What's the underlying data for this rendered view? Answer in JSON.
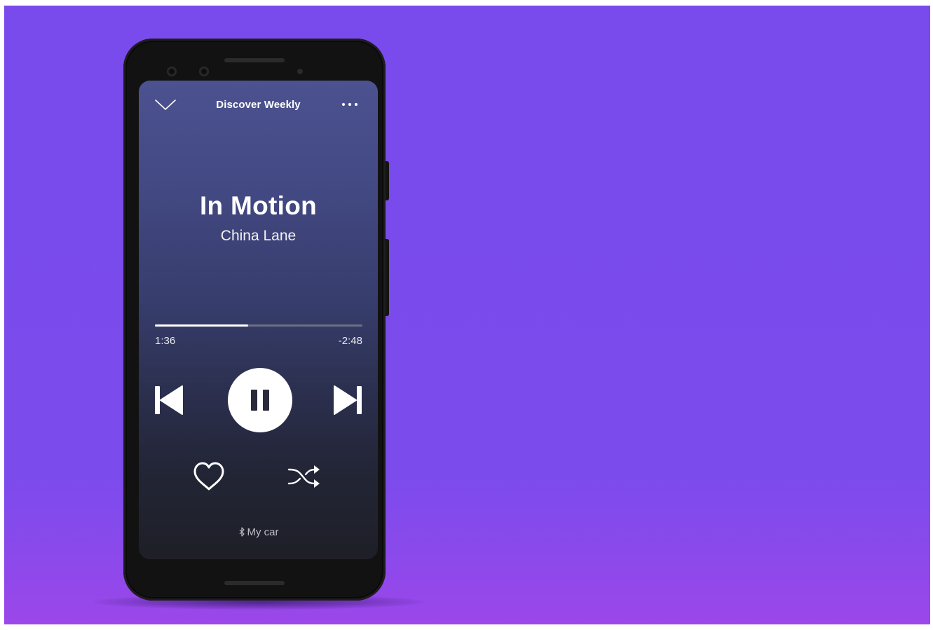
{
  "player": {
    "context_title": "Discover Weekly",
    "track_title": "In Motion",
    "artist": "China Lane",
    "elapsed": "1:36",
    "remaining": "-2:48",
    "progress_fraction": 0.45,
    "device_label": "My car",
    "icons": {
      "collapse": "chevron-down-icon",
      "more": "more-options-icon",
      "previous": "skip-previous-icon",
      "pause": "pause-icon",
      "next": "skip-next-icon",
      "like": "heart-icon",
      "shuffle": "shuffle-icon",
      "bluetooth": "bluetooth-icon"
    }
  },
  "colors": {
    "background": "#7b4bec",
    "phone_body": "#121212",
    "screen_top": "#4c5290",
    "screen_bottom": "#1e1f27",
    "progress_track": "#6b6e86",
    "accent": "#ffffff"
  }
}
